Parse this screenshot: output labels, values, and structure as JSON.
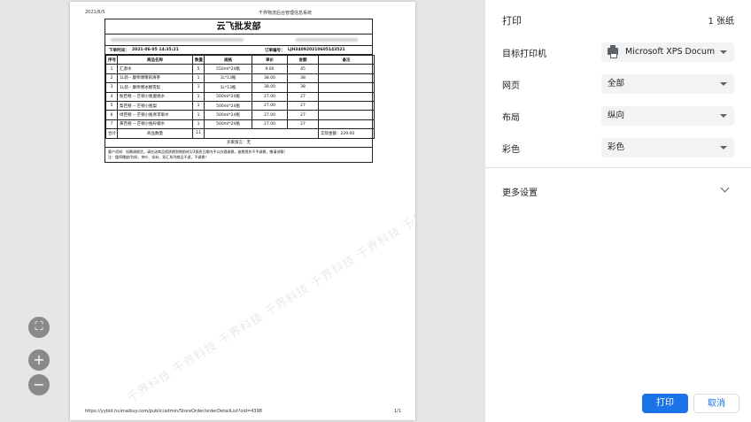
{
  "preview": {
    "header_date": "2021/6/5",
    "header_title": "千界物流后台管理信息系统",
    "footer_url": "https://yybld.huimaibuy.com/public/admin/StoreOrder/orderDetailList?oid=4398",
    "footer_page": "1/1",
    "watermark": "千界科技 千界科技 千界科技 千界科技 千界科技 千界科技 千界科技 千界科技 千界科技",
    "zoom_fit_symbol": "⛶",
    "zoom_in_symbol": "+",
    "zoom_out_symbol": "−"
  },
  "invoice": {
    "company": "云飞批发部",
    "order_time_label": "下单时间：",
    "order_time": "2021-06-05 14:35:21",
    "order_no_label": "订单编号：",
    "order_no": "LJH340920210605143521",
    "columns": [
      "序号",
      "商品名称",
      "数量",
      "规格",
      "单价",
      "金额",
      "备注"
    ],
    "rows": [
      [
        "1",
        "汇源水",
        "5",
        "550ml*24瓶",
        "9.00",
        "45",
        ""
      ],
      [
        "2",
        "1L装-- 康师傅茉莉清茶",
        "1",
        "1L*13瓶",
        "38.00",
        "38",
        ""
      ],
      [
        "3",
        "1L装-- 康师傅冰糖雪梨",
        "1",
        "1L*13瓶",
        "38.00",
        "38",
        ""
      ],
      [
        "4",
        "粉芭顿 -- 芒顿小瓶蜜桃水",
        "1",
        "500ml*24瓶",
        "27.00",
        "27",
        ""
      ],
      [
        "5",
        "梨芭顿 -- 芒顿小瓶梨",
        "1",
        "500ml*24瓶",
        "27.00",
        "27",
        ""
      ],
      [
        "6",
        "绿芭顿 -- 芒顿小瓶青苹果水",
        "1",
        "500ml*24瓶",
        "27.00",
        "27",
        ""
      ],
      [
        "7",
        "黄芭顿 -- 芒顿小瓶柠檬水",
        "1",
        "500ml*24瓶",
        "27.00",
        "27",
        ""
      ]
    ],
    "total_label": "合计",
    "qty_label": "商品数量",
    "total_qty": "11",
    "paid_label": "实际金额：",
    "paid_amount": "229.00",
    "buyer_note": "买家留言：无",
    "note_line1": "客户须知：如需调换货，请在送商品保质期到期前的1/3保质日期内予以办理调换，逾期视作不予调换，敬请谅解！",
    "note_line2": "注：缓停播放/饮料、茶叶、实料、双汇系列商品不退，不调换！"
  },
  "panel": {
    "title": "打印",
    "sheet_count": "1 张纸",
    "destination_label": "目标打印机",
    "destination_value": "Microsoft XPS Docum",
    "pages_label": "网页",
    "pages_value": "全部",
    "layout_label": "布局",
    "layout_value": "纵向",
    "color_label": "彩色",
    "color_value": "彩色",
    "more_settings": "更多设置",
    "print_button": "打印",
    "cancel_button": "取消"
  }
}
